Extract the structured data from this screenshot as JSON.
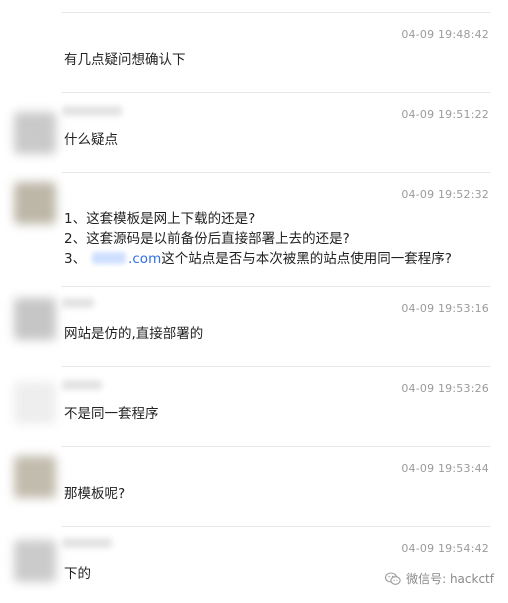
{
  "messages": [
    {
      "time": "04-09 19:48:42",
      "lines": [
        "有几点疑问想确认下"
      ],
      "avatar_color": "#ffffff"
    },
    {
      "time": "04-09 19:51:22",
      "lines": [
        "什么疑点"
      ],
      "avatar_color": "#c9c9c9"
    },
    {
      "time": "04-09 19:52:32",
      "lines": [
        "1、这套模板是网上下载的还是?",
        "2、这套源码是以前备份后直接部署上去的还是?"
      ],
      "line3_prefix": "3、",
      "line3_domain_suffix": ".com",
      "line3_rest": "这个站点是否与本次被黑的站点使用同一套程序?",
      "avatar_color": "#bdb7a8"
    },
    {
      "time": "04-09 19:53:16",
      "lines": [
        "网站是仿的,直接部署的"
      ],
      "avatar_color": "#c6c6c6"
    },
    {
      "time": "04-09 19:53:26",
      "lines": [
        "不是同一套程序"
      ],
      "avatar_color": "#f2f2f2"
    },
    {
      "time": "04-09 19:53:44",
      "lines": [
        "那模板呢?"
      ],
      "avatar_color": "#c2bcae"
    },
    {
      "time": "04-09 19:54:42",
      "lines": [
        "下的"
      ],
      "avatar_color": "#cbcbcb"
    }
  ],
  "watermark": {
    "text": "微信号: hackctf",
    "icon": "wechat-icon"
  }
}
